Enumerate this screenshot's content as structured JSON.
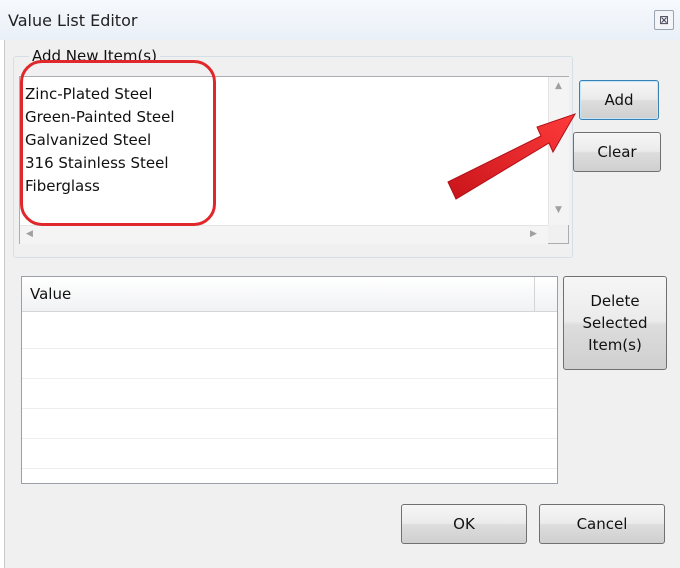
{
  "window": {
    "title": "Value List Editor",
    "close_glyph": "⊠"
  },
  "add_group": {
    "label": "Add New Item(s)",
    "items": [
      "Zinc-Plated Steel",
      "Green-Painted Steel",
      "Galvanized Steel",
      "316 Stainless Steel",
      "Fiberglass"
    ]
  },
  "buttons": {
    "add": "Add",
    "clear": "Clear",
    "delete": [
      "Delete",
      "Selected",
      "Item(s)"
    ],
    "ok": "OK",
    "cancel": "Cancel"
  },
  "list": {
    "column_header": "Value"
  },
  "scroll_glyphs": {
    "up": "▲",
    "down": "▼",
    "left": "◀",
    "right": "▶"
  },
  "annotation": {
    "color": "#e0272b"
  }
}
